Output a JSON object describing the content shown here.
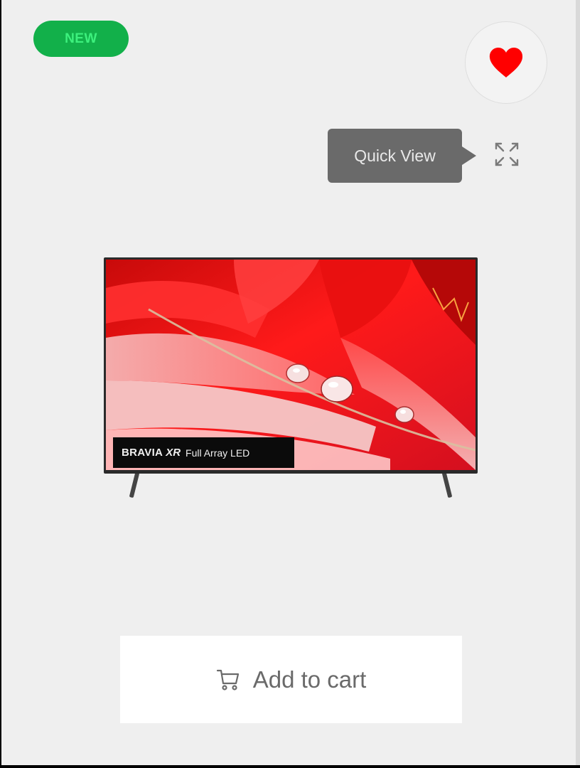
{
  "badge": {
    "label": "NEW",
    "color": "#12b04a"
  },
  "wishlist": {
    "icon": "heart-icon",
    "color": "#ff0000"
  },
  "quick_view": {
    "tooltip": "Quick View",
    "icon": "expand-icon"
  },
  "product": {
    "screen_label": {
      "brand": "BRAVIA",
      "model": "XR",
      "type": "Full Array LED"
    }
  },
  "cart": {
    "label": "Add to cart",
    "icon": "cart-icon"
  },
  "colors": {
    "card_bg": "#efefef",
    "tooltip_bg": "#6a6a6a",
    "cart_text": "#6a6a6a"
  }
}
